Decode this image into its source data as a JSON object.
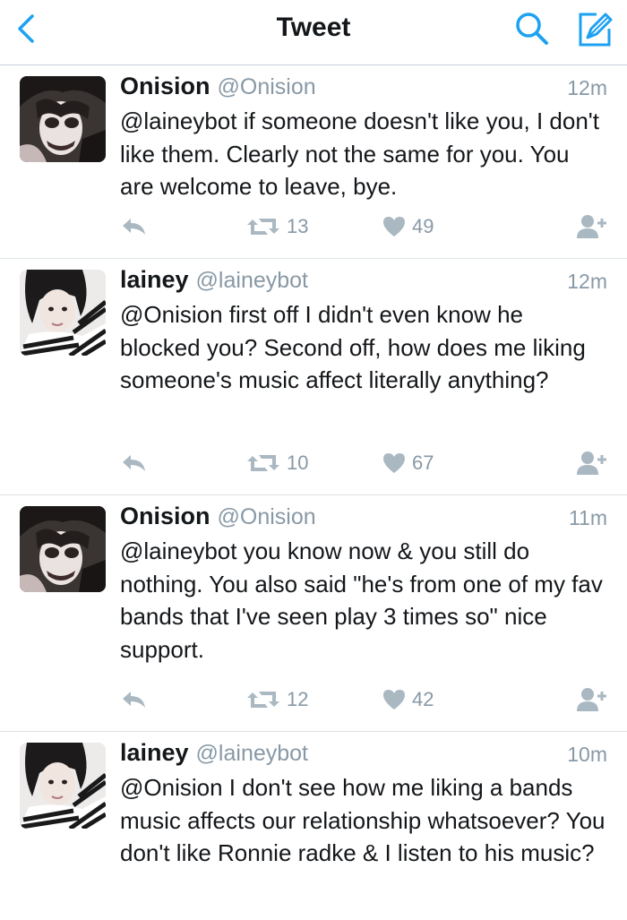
{
  "nav": {
    "title": "Tweet",
    "back_icon": "chevron-left-icon",
    "search_icon": "search-icon",
    "compose_icon": "compose-icon",
    "accent_color": "#1da1f2"
  },
  "tweets": [
    {
      "name": "Onision",
      "handle": "@Onision",
      "time": "12m",
      "text": "@laineybot if someone doesn't like you, I don't like them. Clearly not the same for you. You are welcome to leave, bye.",
      "retweets": "13",
      "likes": "49"
    },
    {
      "name": "lainey",
      "handle": "@laineybot",
      "time": "12m",
      "text": "@Onision first off I didn't even know he blocked you? Second off, how does me liking someone's music affect literally anything?",
      "retweets": "10",
      "likes": "67"
    },
    {
      "name": "Onision",
      "handle": "@Onision",
      "time": "11m",
      "text": "@laineybot you know now & you still do nothing. You also said \"he's from one of my fav bands that I've seen play 3 times so\" nice support.",
      "retweets": "12",
      "likes": "42"
    },
    {
      "name": "lainey",
      "handle": "@laineybot",
      "time": "10m",
      "text": "@Onision I don't see how me liking a bands music affects our relationship whatsoever? You don't like Ronnie radke & I listen to his music?"
    }
  ]
}
